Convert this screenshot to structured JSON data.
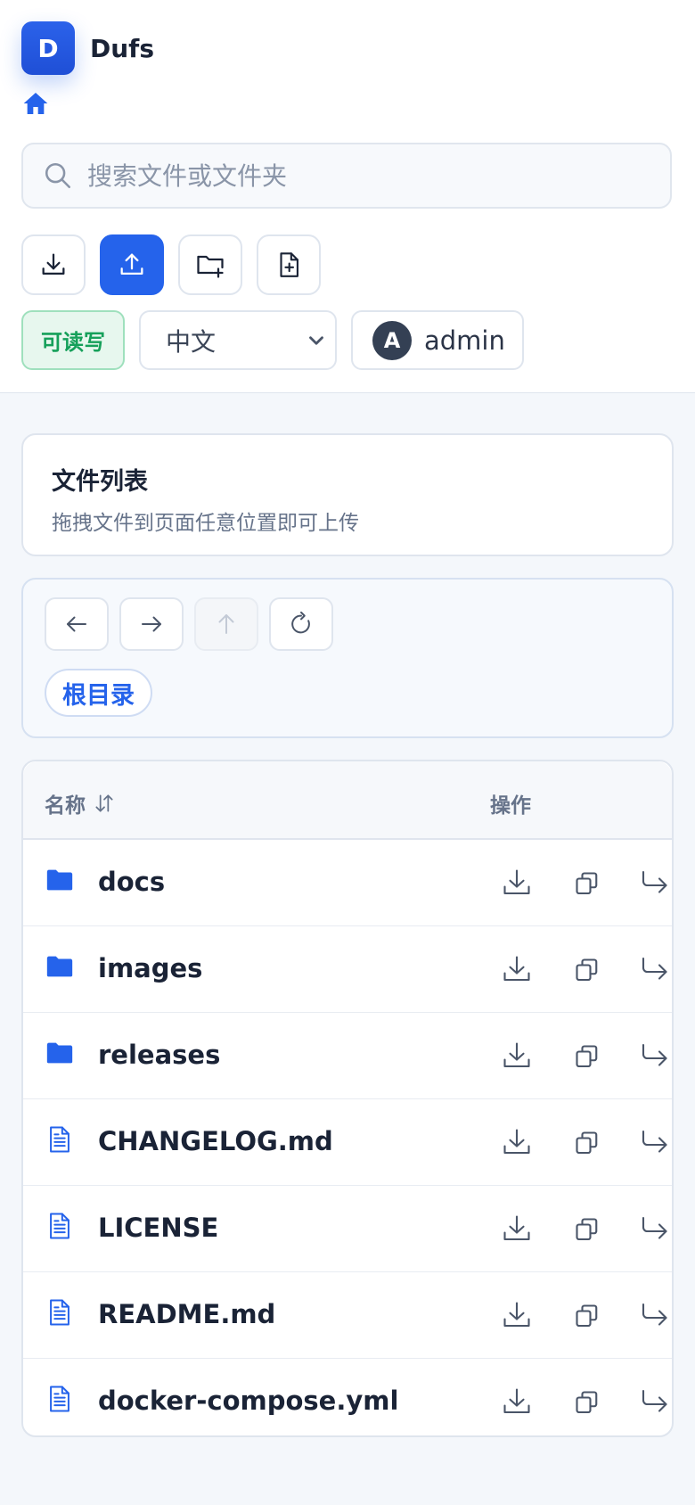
{
  "app": {
    "logo_letter": "D",
    "title": "Dufs"
  },
  "search": {
    "placeholder": "搜索文件或文件夹"
  },
  "status": {
    "permission": "可读写"
  },
  "language": {
    "selected": "中文"
  },
  "user": {
    "avatar_letter": "A",
    "name": "admin"
  },
  "intro": {
    "title": "文件列表",
    "subtitle": "拖拽文件到页面任意位置即可上传"
  },
  "breadcrumb": {
    "root": "根目录"
  },
  "table": {
    "col_name": "名称",
    "col_actions": "操作",
    "rows": [
      {
        "name": "docs",
        "type": "folder"
      },
      {
        "name": "images",
        "type": "folder"
      },
      {
        "name": "releases",
        "type": "folder"
      },
      {
        "name": "CHANGELOG.md",
        "type": "file"
      },
      {
        "name": "LICENSE",
        "type": "file"
      },
      {
        "name": "README.md",
        "type": "file"
      },
      {
        "name": "docker-compose.yml",
        "type": "file"
      }
    ]
  },
  "colors": {
    "primary": "#2563eb",
    "success": "#16a05a"
  }
}
